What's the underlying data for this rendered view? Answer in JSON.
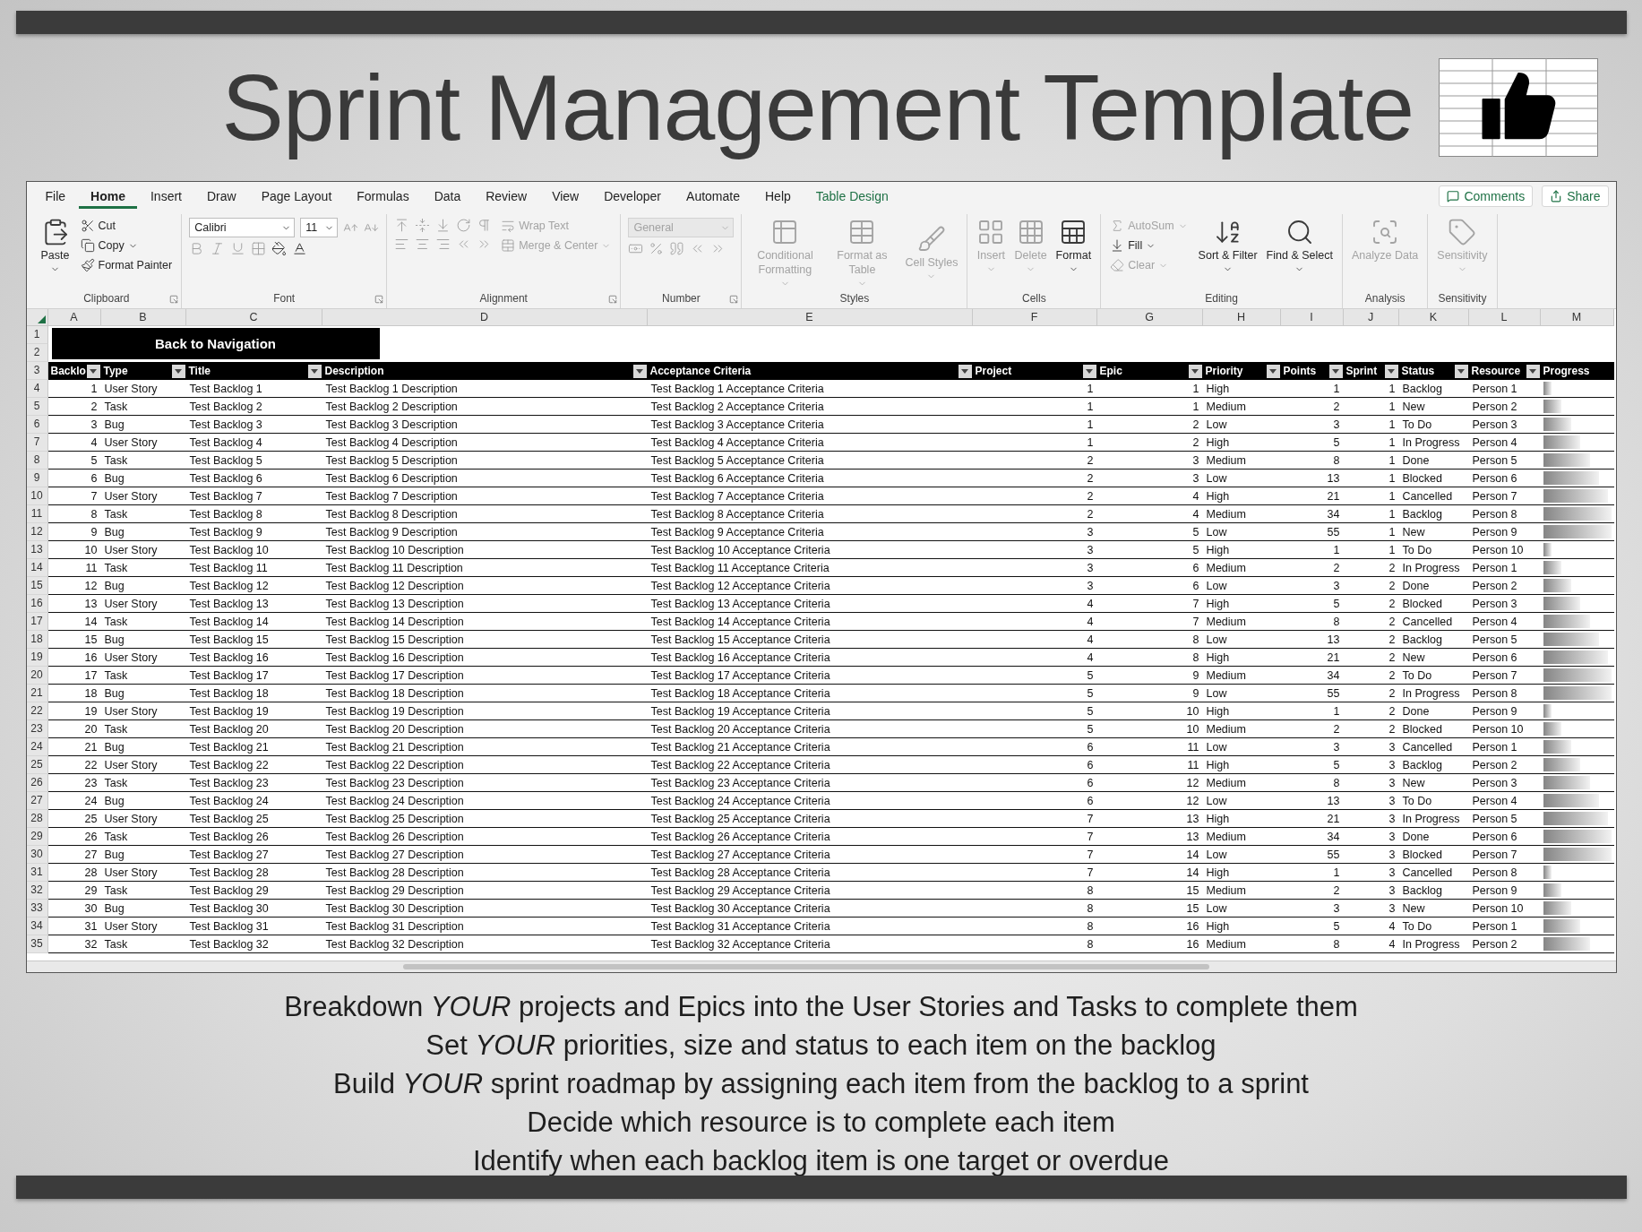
{
  "title": "Sprint Management Template",
  "ribbon_tabs": [
    {
      "label": "File",
      "selected": false,
      "contextual": false
    },
    {
      "label": "Home",
      "selected": true,
      "contextual": false
    },
    {
      "label": "Insert",
      "selected": false,
      "contextual": false
    },
    {
      "label": "Draw",
      "selected": false,
      "contextual": false
    },
    {
      "label": "Page Layout",
      "selected": false,
      "contextual": false
    },
    {
      "label": "Formulas",
      "selected": false,
      "contextual": false
    },
    {
      "label": "Data",
      "selected": false,
      "contextual": false
    },
    {
      "label": "Review",
      "selected": false,
      "contextual": false
    },
    {
      "label": "View",
      "selected": false,
      "contextual": false
    },
    {
      "label": "Developer",
      "selected": false,
      "contextual": false
    },
    {
      "label": "Automate",
      "selected": false,
      "contextual": false
    },
    {
      "label": "Help",
      "selected": false,
      "contextual": false
    },
    {
      "label": "Table Design",
      "selected": false,
      "contextual": true
    }
  ],
  "ribbon_actions": [
    {
      "label": "Comments"
    },
    {
      "label": "Share"
    }
  ],
  "ribbon_groups": [
    {
      "label": "Clipboard",
      "launcher": true,
      "columns": [
        [
          [
            {
              "kind": "large",
              "label": "Paste",
              "menu": true,
              "disabled": false
            }
          ]
        ],
        [
          [
            {
              "kind": "small",
              "label": "Cut",
              "menu": false,
              "disabled": false
            }
          ],
          [
            {
              "kind": "small",
              "label": "Copy",
              "menu": true,
              "disabled": false
            }
          ],
          [
            {
              "kind": "small",
              "label": "Format Painter",
              "menu": false,
              "disabled": false
            }
          ]
        ]
      ]
    },
    {
      "label": "Font",
      "launcher": true,
      "columns": [
        [
          [
            {
              "kind": "field",
              "value": "Calibri",
              "disabled": false
            },
            {
              "kind": "smallfield",
              "value": "11",
              "disabled": false
            },
            {
              "kind": "icon",
              "disabled": true
            },
            {
              "kind": "icon",
              "disabled": true
            }
          ],
          [
            {
              "kind": "icon",
              "disabled": true
            },
            {
              "kind": "icon",
              "disabled": true
            },
            {
              "kind": "icon",
              "disabled": true
            },
            {
              "kind": "icon",
              "disabled": true
            },
            {
              "kind": "icon",
              "disabled": false
            },
            {
              "kind": "icon",
              "disabled": false
            }
          ]
        ]
      ]
    },
    {
      "label": "Alignment",
      "launcher": true,
      "columns": [
        [
          [
            {
              "kind": "icon",
              "disabled": true
            },
            {
              "kind": "icon",
              "disabled": true
            },
            {
              "kind": "icon",
              "disabled": true
            },
            {
              "kind": "icon",
              "disabled": true
            },
            {
              "kind": "icon",
              "disabled": true
            }
          ],
          [
            {
              "kind": "icon",
              "disabled": true
            },
            {
              "kind": "icon",
              "disabled": true
            },
            {
              "kind": "icon",
              "disabled": true
            },
            {
              "kind": "icon",
              "disabled": true
            },
            {
              "kind": "icon",
              "disabled": true
            }
          ]
        ],
        [
          [
            {
              "kind": "small",
              "label": "Wrap Text",
              "menu": false,
              "disabled": true
            }
          ],
          [
            {
              "kind": "small",
              "label": "Merge & Center",
              "menu": true,
              "disabled": true
            }
          ]
        ]
      ]
    },
    {
      "label": "Number",
      "launcher": true,
      "columns": [
        [
          [
            {
              "kind": "field",
              "value": "General",
              "disabled": true
            }
          ],
          [
            {
              "kind": "icon",
              "disabled": true
            },
            {
              "kind": "icon",
              "disabled": true
            },
            {
              "kind": "icon",
              "disabled": true
            },
            {
              "kind": "icon",
              "disabled": true
            },
            {
              "kind": "icon",
              "disabled": true
            }
          ]
        ]
      ]
    },
    {
      "label": "Styles",
      "launcher": false,
      "columns": [
        [
          [
            {
              "kind": "large",
              "label": "Conditional Formatting",
              "menu": true,
              "disabled": true
            },
            {
              "kind": "large",
              "label": "Format as Table",
              "menu": true,
              "disabled": true
            },
            {
              "kind": "large",
              "label": "Cell Styles",
              "menu": true,
              "disabled": true
            }
          ]
        ]
      ]
    },
    {
      "label": "Cells",
      "launcher": false,
      "columns": [
        [
          [
            {
              "kind": "large",
              "label": "Insert",
              "menu": true,
              "disabled": true
            },
            {
              "kind": "large",
              "label": "Delete",
              "menu": true,
              "disabled": true
            },
            {
              "kind": "large",
              "label": "Format",
              "menu": true,
              "disabled": false
            }
          ]
        ]
      ]
    },
    {
      "label": "Editing",
      "launcher": false,
      "columns": [
        [
          [
            {
              "kind": "small",
              "label": "AutoSum",
              "menu": true,
              "disabled": true
            }
          ],
          [
            {
              "kind": "small",
              "label": "Fill",
              "menu": true,
              "disabled": false
            }
          ],
          [
            {
              "kind": "small",
              "label": "Clear",
              "menu": true,
              "disabled": true
            }
          ]
        ],
        [
          [
            {
              "kind": "large",
              "label": "Sort & Filter",
              "menu": true,
              "disabled": false
            },
            {
              "kind": "large",
              "label": "Find & Select",
              "menu": true,
              "disabled": false
            }
          ]
        ]
      ]
    },
    {
      "label": "Analysis",
      "launcher": false,
      "columns": [
        [
          [
            {
              "kind": "large",
              "label": "Analyze Data",
              "menu": false,
              "disabled": true
            }
          ]
        ]
      ]
    },
    {
      "label": "Sensitivity",
      "launcher": false,
      "columns": [
        [
          [
            {
              "kind": "large",
              "label": "Sensitivity",
              "menu": true,
              "disabled": true
            }
          ]
        ]
      ]
    }
  ],
  "sheet": {
    "column_letters": [
      "A",
      "B",
      "C",
      "D",
      "E",
      "F",
      "G",
      "H",
      "I",
      "J",
      "K",
      "L",
      "M"
    ],
    "nav_row_numbers": [
      "1",
      "2"
    ],
    "nav_button": "Back to Navigation",
    "header_row_number": "3",
    "columns": [
      {
        "label": "Backlo",
        "filter": true
      },
      {
        "label": "Type",
        "filter": true
      },
      {
        "label": "Title",
        "filter": true
      },
      {
        "label": "Description",
        "filter": true
      },
      {
        "label": "Acceptance Criteria",
        "filter": true
      },
      {
        "label": "Project",
        "filter": true
      },
      {
        "label": "Epic",
        "filter": true
      },
      {
        "label": "Priority",
        "filter": true
      },
      {
        "label": "Points",
        "filter": true
      },
      {
        "label": "Sprint",
        "filter": true
      },
      {
        "label": "Status",
        "filter": true
      },
      {
        "label": "Resource",
        "filter": true
      },
      {
        "label": "Progress",
        "filter": false
      }
    ],
    "rows": [
      {
        "row_number": "4",
        "backlog": "1",
        "type": "User Story",
        "title": "Test Backlog 1",
        "description": "Test Backlog 1 Description",
        "acceptance_criteria": "Test Backlog 1 Acceptance Criteria",
        "project": "1",
        "epic": "1",
        "priority": "High",
        "points": "1",
        "sprint": "1",
        "status": "Backlog",
        "resource": "Person 1",
        "progress": {
          "level": 0.12
        }
      },
      {
        "row_number": "5",
        "backlog": "2",
        "type": "Task",
        "title": "Test Backlog 2",
        "description": "Test Backlog 2 Description",
        "acceptance_criteria": "Test Backlog 2 Acceptance Criteria",
        "project": "1",
        "epic": "1",
        "priority": "Medium",
        "points": "2",
        "sprint": "1",
        "status": "New",
        "resource": "Person 2",
        "progress": {
          "level": 0.27
        }
      },
      {
        "row_number": "6",
        "backlog": "3",
        "type": "Bug",
        "title": "Test Backlog 3",
        "description": "Test Backlog 3 Description",
        "acceptance_criteria": "Test Backlog 3 Acceptance Criteria",
        "project": "1",
        "epic": "2",
        "priority": "Low",
        "points": "3",
        "sprint": "1",
        "status": "To Do",
        "resource": "Person 3",
        "progress": {
          "level": 0.41
        }
      },
      {
        "row_number": "7",
        "backlog": "4",
        "type": "User Story",
        "title": "Test Backlog 4",
        "description": "Test Backlog 4 Description",
        "acceptance_criteria": "Test Backlog 4 Acceptance Criteria",
        "project": "1",
        "epic": "2",
        "priority": "High",
        "points": "5",
        "sprint": "1",
        "status": "In Progress",
        "resource": "Person 4",
        "progress": {
          "level": 0.55
        }
      },
      {
        "row_number": "8",
        "backlog": "5",
        "type": "Task",
        "title": "Test Backlog 5",
        "description": "Test Backlog 5 Description",
        "acceptance_criteria": "Test Backlog 5 Acceptance Criteria",
        "project": "2",
        "epic": "3",
        "priority": "Medium",
        "points": "8",
        "sprint": "1",
        "status": "Done",
        "resource": "Person 5",
        "progress": {
          "level": 0.69
        }
      },
      {
        "row_number": "9",
        "backlog": "6",
        "type": "Bug",
        "title": "Test Backlog 6",
        "description": "Test Backlog 6 Description",
        "acceptance_criteria": "Test Backlog 6 Acceptance Criteria",
        "project": "2",
        "epic": "3",
        "priority": "Low",
        "points": "13",
        "sprint": "1",
        "status": "Blocked",
        "resource": "Person 6",
        "progress": {
          "level": 0.82
        }
      },
      {
        "row_number": "10",
        "backlog": "7",
        "type": "User Story",
        "title": "Test Backlog 7",
        "description": "Test Backlog 7 Description",
        "acceptance_criteria": "Test Backlog 7 Acceptance Criteria",
        "project": "2",
        "epic": "4",
        "priority": "High",
        "points": "21",
        "sprint": "1",
        "status": "Cancelled",
        "resource": "Person 7",
        "progress": {
          "level": 0.96
        }
      },
      {
        "row_number": "11",
        "backlog": "8",
        "type": "Task",
        "title": "Test Backlog 8",
        "description": "Test Backlog 8 Description",
        "acceptance_criteria": "Test Backlog 8 Acceptance Criteria",
        "project": "2",
        "epic": "4",
        "priority": "Medium",
        "points": "34",
        "sprint": "1",
        "status": "Backlog",
        "resource": "Person 8",
        "progress": {
          "level": 1
        }
      },
      {
        "row_number": "12",
        "backlog": "9",
        "type": "Bug",
        "title": "Test Backlog 9",
        "description": "Test Backlog 9 Description",
        "acceptance_criteria": "Test Backlog 9 Acceptance Criteria",
        "project": "3",
        "epic": "5",
        "priority": "Low",
        "points": "55",
        "sprint": "1",
        "status": "New",
        "resource": "Person 9",
        "progress": {
          "level": 1
        }
      },
      {
        "row_number": "13",
        "backlog": "10",
        "type": "User Story",
        "title": "Test Backlog 10",
        "description": "Test Backlog 10 Description",
        "acceptance_criteria": "Test Backlog 10 Acceptance Criteria",
        "project": "3",
        "epic": "5",
        "priority": "High",
        "points": "1",
        "sprint": "1",
        "status": "To Do",
        "resource": "Person 10",
        "progress": {
          "level": 0.12
        }
      },
      {
        "row_number": "14",
        "backlog": "11",
        "type": "Task",
        "title": "Test Backlog 11",
        "description": "Test Backlog 11 Description",
        "acceptance_criteria": "Test Backlog 11 Acceptance Criteria",
        "project": "3",
        "epic": "6",
        "priority": "Medium",
        "points": "2",
        "sprint": "2",
        "status": "In Progress",
        "resource": "Person 1",
        "progress": {
          "level": 0.27
        }
      },
      {
        "row_number": "15",
        "backlog": "12",
        "type": "Bug",
        "title": "Test Backlog 12",
        "description": "Test Backlog 12 Description",
        "acceptance_criteria": "Test Backlog 12 Acceptance Criteria",
        "project": "3",
        "epic": "6",
        "priority": "Low",
        "points": "3",
        "sprint": "2",
        "status": "Done",
        "resource": "Person 2",
        "progress": {
          "level": 0.41
        }
      },
      {
        "row_number": "16",
        "backlog": "13",
        "type": "User Story",
        "title": "Test Backlog 13",
        "description": "Test Backlog 13 Description",
        "acceptance_criteria": "Test Backlog 13 Acceptance Criteria",
        "project": "4",
        "epic": "7",
        "priority": "High",
        "points": "5",
        "sprint": "2",
        "status": "Blocked",
        "resource": "Person 3",
        "progress": {
          "level": 0.55
        }
      },
      {
        "row_number": "17",
        "backlog": "14",
        "type": "Task",
        "title": "Test Backlog 14",
        "description": "Test Backlog 14 Description",
        "acceptance_criteria": "Test Backlog 14 Acceptance Criteria",
        "project": "4",
        "epic": "7",
        "priority": "Medium",
        "points": "8",
        "sprint": "2",
        "status": "Cancelled",
        "resource": "Person 4",
        "progress": {
          "level": 0.69
        }
      },
      {
        "row_number": "18",
        "backlog": "15",
        "type": "Bug",
        "title": "Test Backlog 15",
        "description": "Test Backlog 15 Description",
        "acceptance_criteria": "Test Backlog 15 Acceptance Criteria",
        "project": "4",
        "epic": "8",
        "priority": "Low",
        "points": "13",
        "sprint": "2",
        "status": "Backlog",
        "resource": "Person 5",
        "progress": {
          "level": 0.82
        }
      },
      {
        "row_number": "19",
        "backlog": "16",
        "type": "User Story",
        "title": "Test Backlog 16",
        "description": "Test Backlog 16 Description",
        "acceptance_criteria": "Test Backlog 16 Acceptance Criteria",
        "project": "4",
        "epic": "8",
        "priority": "High",
        "points": "21",
        "sprint": "2",
        "status": "New",
        "resource": "Person 6",
        "progress": {
          "level": 0.96
        }
      },
      {
        "row_number": "20",
        "backlog": "17",
        "type": "Task",
        "title": "Test Backlog 17",
        "description": "Test Backlog 17 Description",
        "acceptance_criteria": "Test Backlog 17 Acceptance Criteria",
        "project": "5",
        "epic": "9",
        "priority": "Medium",
        "points": "34",
        "sprint": "2",
        "status": "To Do",
        "resource": "Person 7",
        "progress": {
          "level": 1
        }
      },
      {
        "row_number": "21",
        "backlog": "18",
        "type": "Bug",
        "title": "Test Backlog 18",
        "description": "Test Backlog 18 Description",
        "acceptance_criteria": "Test Backlog 18 Acceptance Criteria",
        "project": "5",
        "epic": "9",
        "priority": "Low",
        "points": "55",
        "sprint": "2",
        "status": "In Progress",
        "resource": "Person 8",
        "progress": {
          "level": 1
        }
      },
      {
        "row_number": "22",
        "backlog": "19",
        "type": "User Story",
        "title": "Test Backlog 19",
        "description": "Test Backlog 19 Description",
        "acceptance_criteria": "Test Backlog 19 Acceptance Criteria",
        "project": "5",
        "epic": "10",
        "priority": "High",
        "points": "1",
        "sprint": "2",
        "status": "Done",
        "resource": "Person 9",
        "progress": {
          "level": 0.12
        }
      },
      {
        "row_number": "23",
        "backlog": "20",
        "type": "Task",
        "title": "Test Backlog 20",
        "description": "Test Backlog 20 Description",
        "acceptance_criteria": "Test Backlog 20 Acceptance Criteria",
        "project": "5",
        "epic": "10",
        "priority": "Medium",
        "points": "2",
        "sprint": "2",
        "status": "Blocked",
        "resource": "Person 10",
        "progress": {
          "level": 0.27
        }
      },
      {
        "row_number": "24",
        "backlog": "21",
        "type": "Bug",
        "title": "Test Backlog 21",
        "description": "Test Backlog 21 Description",
        "acceptance_criteria": "Test Backlog 21 Acceptance Criteria",
        "project": "6",
        "epic": "11",
        "priority": "Low",
        "points": "3",
        "sprint": "3",
        "status": "Cancelled",
        "resource": "Person 1",
        "progress": {
          "level": 0.41
        }
      },
      {
        "row_number": "25",
        "backlog": "22",
        "type": "User Story",
        "title": "Test Backlog 22",
        "description": "Test Backlog 22 Description",
        "acceptance_criteria": "Test Backlog 22 Acceptance Criteria",
        "project": "6",
        "epic": "11",
        "priority": "High",
        "points": "5",
        "sprint": "3",
        "status": "Backlog",
        "resource": "Person 2",
        "progress": {
          "level": 0.55
        }
      },
      {
        "row_number": "26",
        "backlog": "23",
        "type": "Task",
        "title": "Test Backlog 23",
        "description": "Test Backlog 23 Description",
        "acceptance_criteria": "Test Backlog 23 Acceptance Criteria",
        "project": "6",
        "epic": "12",
        "priority": "Medium",
        "points": "8",
        "sprint": "3",
        "status": "New",
        "resource": "Person 3",
        "progress": {
          "level": 0.69
        }
      },
      {
        "row_number": "27",
        "backlog": "24",
        "type": "Bug",
        "title": "Test Backlog 24",
        "description": "Test Backlog 24 Description",
        "acceptance_criteria": "Test Backlog 24 Acceptance Criteria",
        "project": "6",
        "epic": "12",
        "priority": "Low",
        "points": "13",
        "sprint": "3",
        "status": "To Do",
        "resource": "Person 4",
        "progress": {
          "level": 0.82
        }
      },
      {
        "row_number": "28",
        "backlog": "25",
        "type": "User Story",
        "title": "Test Backlog 25",
        "description": "Test Backlog 25 Description",
        "acceptance_criteria": "Test Backlog 25 Acceptance Criteria",
        "project": "7",
        "epic": "13",
        "priority": "High",
        "points": "21",
        "sprint": "3",
        "status": "In Progress",
        "resource": "Person 5",
        "progress": {
          "level": 0.96
        }
      },
      {
        "row_number": "29",
        "backlog": "26",
        "type": "Task",
        "title": "Test Backlog 26",
        "description": "Test Backlog 26 Description",
        "acceptance_criteria": "Test Backlog 26 Acceptance Criteria",
        "project": "7",
        "epic": "13",
        "priority": "Medium",
        "points": "34",
        "sprint": "3",
        "status": "Done",
        "resource": "Person 6",
        "progress": {
          "level": 1
        }
      },
      {
        "row_number": "30",
        "backlog": "27",
        "type": "Bug",
        "title": "Test Backlog 27",
        "description": "Test Backlog 27 Description",
        "acceptance_criteria": "Test Backlog 27 Acceptance Criteria",
        "project": "7",
        "epic": "14",
        "priority": "Low",
        "points": "55",
        "sprint": "3",
        "status": "Blocked",
        "resource": "Person 7",
        "progress": {
          "level": 1
        }
      },
      {
        "row_number": "31",
        "backlog": "28",
        "type": "User Story",
        "title": "Test Backlog 28",
        "description": "Test Backlog 28 Description",
        "acceptance_criteria": "Test Backlog 28 Acceptance Criteria",
        "project": "7",
        "epic": "14",
        "priority": "High",
        "points": "1",
        "sprint": "3",
        "status": "Cancelled",
        "resource": "Person 8",
        "progress": {
          "level": 0.12
        }
      },
      {
        "row_number": "32",
        "backlog": "29",
        "type": "Task",
        "title": "Test Backlog 29",
        "description": "Test Backlog 29 Description",
        "acceptance_criteria": "Test Backlog 29 Acceptance Criteria",
        "project": "8",
        "epic": "15",
        "priority": "Medium",
        "points": "2",
        "sprint": "3",
        "status": "Backlog",
        "resource": "Person 9",
        "progress": {
          "level": 0.27
        }
      },
      {
        "row_number": "33",
        "backlog": "30",
        "type": "Bug",
        "title": "Test Backlog 30",
        "description": "Test Backlog 30 Description",
        "acceptance_criteria": "Test Backlog 30 Acceptance Criteria",
        "project": "8",
        "epic": "15",
        "priority": "Low",
        "points": "3",
        "sprint": "3",
        "status": "New",
        "resource": "Person 10",
        "progress": {
          "level": 0.41
        }
      },
      {
        "row_number": "34",
        "backlog": "31",
        "type": "User Story",
        "title": "Test Backlog 31",
        "description": "Test Backlog 31 Description",
        "acceptance_criteria": "Test Backlog 31 Acceptance Criteria",
        "project": "8",
        "epic": "16",
        "priority": "High",
        "points": "5",
        "sprint": "4",
        "status": "To Do",
        "resource": "Person 1",
        "progress": {
          "level": 0.55
        }
      },
      {
        "row_number": "35",
        "backlog": "32",
        "type": "Task",
        "title": "Test Backlog 32",
        "description": "Test Backlog 32 Description",
        "acceptance_criteria": "Test Backlog 32 Acceptance Criteria",
        "project": "8",
        "epic": "16",
        "priority": "Medium",
        "points": "8",
        "sprint": "4",
        "status": "In Progress",
        "resource": "Person 2",
        "progress": {
          "level": 0.69
        }
      }
    ]
  },
  "captions": [
    "Breakdown *YOUR* projects and Epics into the User Stories and Tasks to complete them",
    "Set *YOUR* priorities, size and status to each item on the backlog",
    "Build *YOUR* sprint roadmap by assigning each item from the backlog to a sprint",
    "Decide which resource is to complete each item",
    "Identify when each backlog item is one target or overdue"
  ]
}
